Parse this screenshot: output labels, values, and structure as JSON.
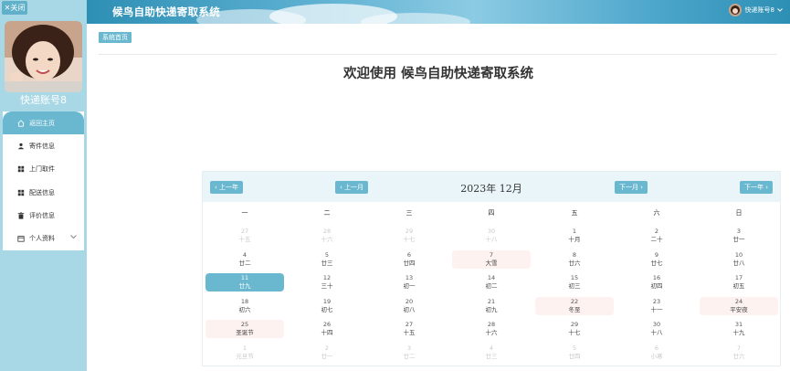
{
  "sidebar": {
    "close_label": "✕关闭",
    "account_name": "快递账号8",
    "items": [
      {
        "label": "返回主页",
        "icon": "home-icon"
      },
      {
        "label": "寄件信息",
        "icon": "person-icon"
      },
      {
        "label": "上门取件",
        "icon": "grid-icon"
      },
      {
        "label": "配送信息",
        "icon": "grid-icon"
      },
      {
        "label": "评价信息",
        "icon": "trash-icon"
      },
      {
        "label": "个人资料",
        "icon": "calendar-icon"
      }
    ]
  },
  "header": {
    "title": "候鸟自助快递寄取系统",
    "user_label": "快递账号8",
    "dropdown_icon": "chevron-down-icon"
  },
  "main": {
    "breadcrumb": "系统首页",
    "welcome": "欢迎使用 候鸟自助快递寄取系统"
  },
  "calendar": {
    "title": "2023年 12月",
    "prev_year": "上一年",
    "prev_month": "上一月",
    "next_month": "下一月",
    "next_year": "下一年",
    "weekdays": [
      "一",
      "二",
      "三",
      "四",
      "五",
      "六",
      "日"
    ],
    "weeks": [
      [
        [
          "27",
          "十五",
          "other"
        ],
        [
          "28",
          "十六",
          "other"
        ],
        [
          "29",
          "十七",
          "other"
        ],
        [
          "30",
          "十八",
          "other"
        ],
        [
          "1",
          "十月",
          ""
        ],
        [
          "2",
          "二十",
          ""
        ],
        [
          "3",
          "廿一",
          ""
        ]
      ],
      [
        [
          "4",
          "廿二",
          ""
        ],
        [
          "5",
          "廿三",
          ""
        ],
        [
          "6",
          "廿四",
          ""
        ],
        [
          "7",
          "大雪",
          "hl"
        ],
        [
          "8",
          "廿六",
          ""
        ],
        [
          "9",
          "廿七",
          ""
        ],
        [
          "10",
          "廿八",
          ""
        ]
      ],
      [
        [
          "11",
          "廿九",
          "today"
        ],
        [
          "12",
          "三十",
          ""
        ],
        [
          "13",
          "初一",
          ""
        ],
        [
          "14",
          "初二",
          ""
        ],
        [
          "15",
          "初三",
          ""
        ],
        [
          "16",
          "初四",
          ""
        ],
        [
          "17",
          "初五",
          ""
        ]
      ],
      [
        [
          "18",
          "初六",
          ""
        ],
        [
          "19",
          "初七",
          ""
        ],
        [
          "20",
          "初八",
          ""
        ],
        [
          "21",
          "初九",
          ""
        ],
        [
          "22",
          "冬至",
          "hl"
        ],
        [
          "23",
          "十一",
          ""
        ],
        [
          "24",
          "平安夜",
          "hl"
        ]
      ],
      [
        [
          "25",
          "圣诞节",
          "hl"
        ],
        [
          "26",
          "十四",
          ""
        ],
        [
          "27",
          "十五",
          ""
        ],
        [
          "28",
          "十六",
          ""
        ],
        [
          "29",
          "十七",
          ""
        ],
        [
          "30",
          "十八",
          ""
        ],
        [
          "31",
          "十九",
          ""
        ]
      ],
      [
        [
          "1",
          "元旦节",
          "other"
        ],
        [
          "2",
          "廿一",
          "other"
        ],
        [
          "3",
          "廿二",
          "other"
        ],
        [
          "4",
          "廿三",
          "other"
        ],
        [
          "5",
          "廿四",
          "other"
        ],
        [
          "6",
          "小寒",
          "other"
        ],
        [
          "7",
          "廿六",
          "other"
        ]
      ]
    ]
  },
  "colors": {
    "accent": "#6ab8cf",
    "sidebar_bg": "#a8d8e6",
    "highlight_bg": "#fdf2ef"
  }
}
